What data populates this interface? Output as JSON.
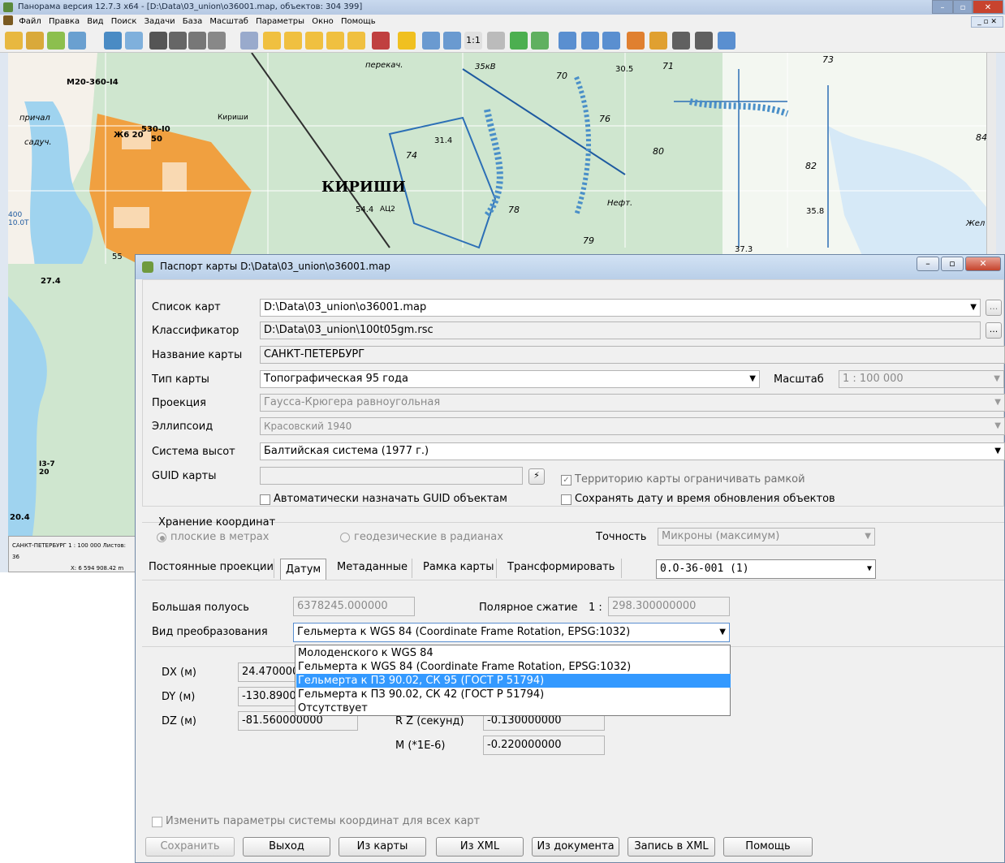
{
  "bg_window": {
    "title": "Панорама версия 12.7.3 x64 - [D:\\Data\\03_union\\o36001.map, объектов: 304 399]",
    "menu": [
      "Файл",
      "Правка",
      "Вид",
      "Поиск",
      "Задачи",
      "База",
      "Масштаб",
      "Параметры",
      "Окно",
      "Помощь"
    ],
    "map_labels": [
      "КИРИШИ",
      "М20-360-I4",
      "530-I0",
      "50",
      "Ж6 20",
      "причал",
      "садуч.",
      "перекач.",
      "35кВ",
      "30.5",
      "71",
      "73",
      "70",
      "76",
      "80",
      "82",
      "84",
      "35.8",
      "37.3",
      "79",
      "54.4",
      "АЦ2",
      "31.4",
      "74",
      "78",
      "27.4",
      "20.4",
      "I3-7",
      "20",
      "400",
      "10.0Т",
      "55",
      "Кириши",
      "Нефт.",
      "Жел"
    ],
    "status_text": [
      "САНКТ-ПЕТЕРБУРГ 1 : 100 000  Листов: 36",
      "X: 6 594 908.42 m"
    ]
  },
  "dialog": {
    "title": "Паспорт карты  D:\\Data\\03_union\\o36001.map",
    "labels": {
      "map_list": "Список карт",
      "classifier": "Классификатор",
      "map_name": "Название карты",
      "map_type": "Тип карты",
      "scale": "Масштаб",
      "projection": "Проекция",
      "ellipsoid": "Эллипсоид",
      "height_system": "Система высот",
      "guid": "GUID карты"
    },
    "values": {
      "map_list": "D:\\Data\\03_union\\o36001.map",
      "classifier": "D:\\Data\\03_union\\100t05gm.rsc",
      "map_name": "САНКТ-ПЕТЕРБУРГ",
      "map_type": "Топографическая 95 года",
      "scale": "1 : 100 000",
      "projection": "Гаусса-Крюгера равноугольная",
      "ellipsoid": "Красовский 1940",
      "height_system": "Балтийская система (1977 г.)",
      "guid": ""
    },
    "ellipsis": "...",
    "guid_btn_icon": "⚡",
    "checkboxes": {
      "limit_frame": {
        "label": "Территорию карты ограничивать рамкой",
        "checked": true
      },
      "auto_guid": {
        "label": "Автоматически назначать GUID объектам",
        "checked": false
      },
      "save_date": {
        "label": "Сохранять дату и время обновления объектов",
        "checked": false
      },
      "change_all": {
        "label": "Изменить параметры системы координат для всех карт",
        "checked": false
      }
    },
    "storage": {
      "legend": "Хранение координат",
      "plane": "плоские в метрах",
      "geodetic": "геодезические в радианах",
      "precision_label": "Точность",
      "precision_value": "Микроны (максимум)"
    },
    "tabs": [
      "Постоянные проекции",
      "Датум",
      "Метаданные",
      "Рамка карты",
      "Трансформировать"
    ],
    "sheet_select": "0.O-36-001  (1)",
    "datum": {
      "major_axis_label": "Большая полуось",
      "major_axis_value": "6378245.000000",
      "flattening_label": "Полярное сжатие",
      "flattening_prefix": "1 :",
      "flattening_value": "298.300000000",
      "transform_label": "Вид преобразования",
      "transform_value": "Гельмерта к WGS 84 (Coordinate Frame Rotation, EPSG:1032)",
      "options": [
        "Молоденского к WGS 84",
        "Гельмерта к WGS 84 (Coordinate Frame Rotation, EPSG:1032)",
        "Гельмерта к ПЗ 90.02, СК 95 (ГОСТ Р 51794)",
        "Гельмерта к ПЗ 90.02, СК 42 (ГОСТ Р 51794)",
        "Отсутствует"
      ],
      "selected_option": 2,
      "dx_label": "DX (м)",
      "dx_value": "24.470000",
      "dy_label": "DY (м)",
      "dy_value": "-130.8900",
      "dz_label": "DZ (м)",
      "dz_value": "-81.560000000",
      "rz_label": "R Z (секунд)",
      "rz_value": "-0.130000000",
      "m_label": "M (*1E-6)",
      "m_value": "-0.220000000"
    },
    "buttons": [
      "Сохранить",
      "Выход",
      "Из карты",
      "Из XML",
      "Из документа",
      "Запись в XML",
      "Помощь"
    ]
  }
}
